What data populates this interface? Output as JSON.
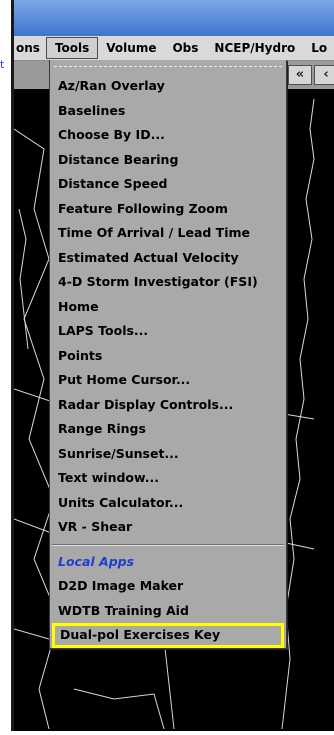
{
  "menubar": {
    "items": [
      "ons",
      "Tools",
      "Volume",
      "Obs",
      "NCEP/Hydro",
      "Lo"
    ],
    "active": "Tools"
  },
  "toolbar": {
    "first_icon": "«",
    "last_icon": "‹"
  },
  "left_fragment": "t",
  "tools_menu": {
    "items": [
      "Az/Ran Overlay",
      "Baselines",
      "Choose By ID...",
      "Distance Bearing",
      "Distance Speed",
      "Feature Following Zoom",
      "Time Of Arrival / Lead Time",
      "Estimated Actual Velocity",
      "4-D Storm Investigator (FSI)",
      "Home",
      "LAPS Tools...",
      "Points",
      "Put Home Cursor...",
      "Radar Display Controls...",
      "Range Rings",
      "Sunrise/Sunset...",
      "Text window...",
      "Units Calculator...",
      "VR - Shear"
    ],
    "local_header": "Local Apps",
    "local_items": [
      "D2D Image Maker",
      "WDTB Training Aid",
      "Dual-pol Exercises Key"
    ],
    "highlighted_item": "Dual-pol Exercises Key"
  },
  "colors": {
    "titlebar": "#3f74cd",
    "menu_bg": "#a9a9a9",
    "local_header": "#1f3fd0",
    "highlight": "#ffff00",
    "map_lines": "#ffffff"
  }
}
